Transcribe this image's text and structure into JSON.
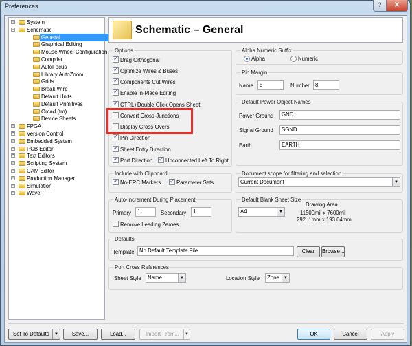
{
  "window": {
    "title": "Preferences",
    "help": "?",
    "close": "✕"
  },
  "tree": [
    {
      "label": "System",
      "level": 0,
      "exp": "+"
    },
    {
      "label": "Schematic",
      "level": 0,
      "exp": "−"
    },
    {
      "label": "General",
      "level": 1,
      "selected": true
    },
    {
      "label": "Graphical Editing",
      "level": 1
    },
    {
      "label": "Mouse Wheel Configuration",
      "level": 1
    },
    {
      "label": "Compiler",
      "level": 1
    },
    {
      "label": "AutoFocus",
      "level": 1
    },
    {
      "label": "Library AutoZoom",
      "level": 1
    },
    {
      "label": "Grids",
      "level": 1
    },
    {
      "label": "Break Wire",
      "level": 1
    },
    {
      "label": "Default Units",
      "level": 1
    },
    {
      "label": "Default Primitives",
      "level": 1
    },
    {
      "label": "Orcad (tm)",
      "level": 1
    },
    {
      "label": "Device Sheets",
      "level": 1
    },
    {
      "label": "FPGA",
      "level": 0,
      "exp": "+"
    },
    {
      "label": "Version Control",
      "level": 0,
      "exp": "+"
    },
    {
      "label": "Embedded System",
      "level": 0,
      "exp": "+"
    },
    {
      "label": "PCB Editor",
      "level": 0,
      "exp": "+"
    },
    {
      "label": "Text Editors",
      "level": 0,
      "exp": "+"
    },
    {
      "label": "Scripting System",
      "level": 0,
      "exp": "+"
    },
    {
      "label": "CAM Editor",
      "level": 0,
      "exp": "+"
    },
    {
      "label": "Production Manager",
      "level": 0,
      "exp": "+"
    },
    {
      "label": "Simulation",
      "level": 0,
      "exp": "+"
    },
    {
      "label": "Wave",
      "level": 0,
      "exp": "+"
    }
  ],
  "header": {
    "title": "Schematic – General"
  },
  "options": {
    "title": "Options",
    "items": [
      {
        "label": "Drag Orthogonal",
        "checked": true
      },
      {
        "label": "Optimize Wires & Buses",
        "checked": true
      },
      {
        "label": "Components Cut Wires",
        "checked": true
      },
      {
        "label": "Enable In-Place Editing",
        "checked": true
      },
      {
        "label": "CTRL+Double Click Opens Sheet",
        "checked": true
      },
      {
        "label": "Convert Cross-Junctions",
        "checked": false
      },
      {
        "label": "Display Cross-Overs",
        "checked": false
      },
      {
        "label": "Pin Direction",
        "checked": true
      },
      {
        "label": "Sheet Entry Direction",
        "checked": true
      },
      {
        "label": "Port Direction",
        "checked": true
      },
      {
        "label": "Unconnected Left To Right",
        "checked": true
      }
    ]
  },
  "suffix": {
    "title": "Alpha Numeric Suffix",
    "alpha": "Alpha",
    "numeric": "Numeric",
    "selected": "Alpha"
  },
  "pin_margin": {
    "title": "Pin Margin",
    "name_label": "Name",
    "name": "5",
    "number_label": "Number",
    "number": "8"
  },
  "power": {
    "title": "Default Power Object Names",
    "power_ground_label": "Power Ground",
    "power_ground": "GND",
    "signal_ground_label": "Signal Ground",
    "signal_ground": "SGND",
    "earth_label": "Earth",
    "earth": "EARTH"
  },
  "clipboard": {
    "title": "Include with Clipboard",
    "no_erc": "No-ERC Markers",
    "param_sets": "Parameter Sets"
  },
  "scope": {
    "title": "Document scope for filtering and selection",
    "value": "Current Document"
  },
  "autoinc": {
    "title": "Auto-Increment During Placement",
    "primary_label": "Primary",
    "primary": "1",
    "secondary_label": "Secondary",
    "secondary": "1",
    "remove_zeroes": "Remove Leading Zeroes"
  },
  "sheet": {
    "title": "Default Blank Sheet Size",
    "value": "A4",
    "area_label": "Drawing Area",
    "area_mil": "11500mil x 7600mil",
    "area_mm": "292. 1mm x 193.04mm"
  },
  "defaults": {
    "title": "Defaults",
    "template_label": "Template",
    "template": "No Default Template File",
    "clear": "Clear",
    "browse": "Browse ..."
  },
  "port_xref": {
    "title": "Port Cross References",
    "sheet_style_label": "Sheet Style",
    "sheet_style": "Name",
    "location_style_label": "Location Style",
    "location_style": "Zone"
  },
  "footer": {
    "set_defaults": "Set To Defaults",
    "save": "Save...",
    "load": "Load...",
    "import": "Import From...",
    "ok": "OK",
    "cancel": "Cancel",
    "apply": "Apply"
  },
  "colors": {
    "highlight": "#ee2b2b",
    "selection": "#3399ff"
  }
}
